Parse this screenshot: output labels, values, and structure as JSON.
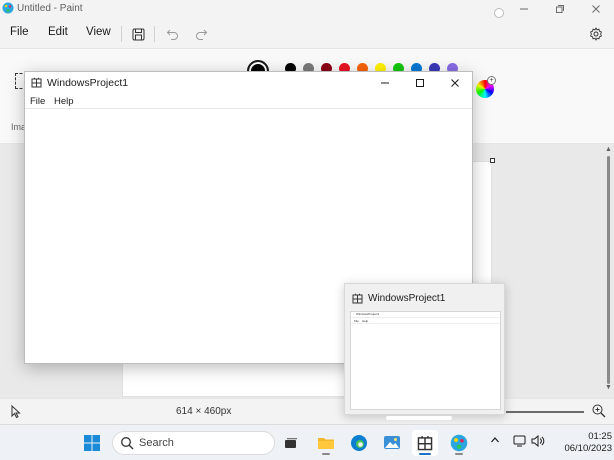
{
  "paint": {
    "title": "Untitled - Paint",
    "menu": [
      "File",
      "Edit",
      "View"
    ],
    "status_size": "614 × 460px",
    "panel_label": "Ima",
    "swatches": [
      "#000000",
      "#7a7a7a",
      "#8b0015",
      "#e81224",
      "#f7630c",
      "#fff100",
      "#16c60c",
      "#0078d4",
      "#3a3ab8",
      "#886ce4"
    ]
  },
  "child": {
    "title": "WindowsProject1",
    "menu": [
      "File",
      "Help"
    ]
  },
  "preview": {
    "title": "WindowsProject1",
    "thumb_title": "WindowsProject1",
    "thumb_menu": [
      "File",
      "Help"
    ]
  },
  "taskbar": {
    "search_label": "Search",
    "time": "01:25",
    "date": "06/10/2023"
  }
}
